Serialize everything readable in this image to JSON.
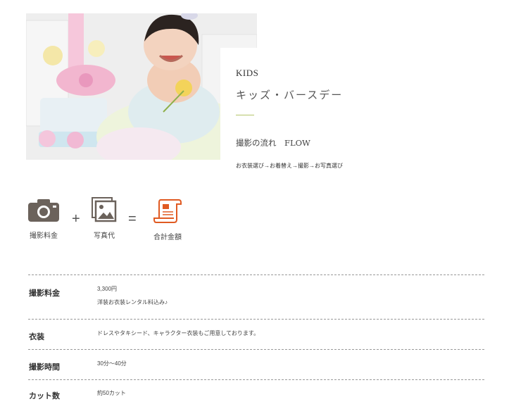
{
  "hero": {
    "en_title": "KIDS",
    "ja_title": "キッズ・バースデー",
    "flow_label": "撮影の流れ　FLOW",
    "flow_steps": "お衣装選び→お着替え→撮影→お写真選び"
  },
  "price_formula": {
    "items": [
      {
        "icon": "camera-icon",
        "label": "撮影料金"
      },
      {
        "icon": "photos-icon",
        "label": "写真代"
      },
      {
        "icon": "invoice-icon",
        "label": "合計金額"
      }
    ],
    "plus": "+",
    "equals": "=",
    "colors": {
      "gray": "#6b625b",
      "orange": "#e05a22"
    }
  },
  "details": {
    "rows": [
      {
        "label": "撮影料金",
        "lines": [
          "3,300円",
          "洋装お衣装レンタル料込み♪"
        ]
      },
      {
        "label": "衣装",
        "lines": [
          "ドレスやタキシード、キャラクター衣装もご用意しております。"
        ]
      },
      {
        "label": "撮影時間",
        "lines": [
          "30分〜40分"
        ]
      },
      {
        "label": "カット数",
        "lines": [
          "約50カット"
        ]
      }
    ]
  }
}
